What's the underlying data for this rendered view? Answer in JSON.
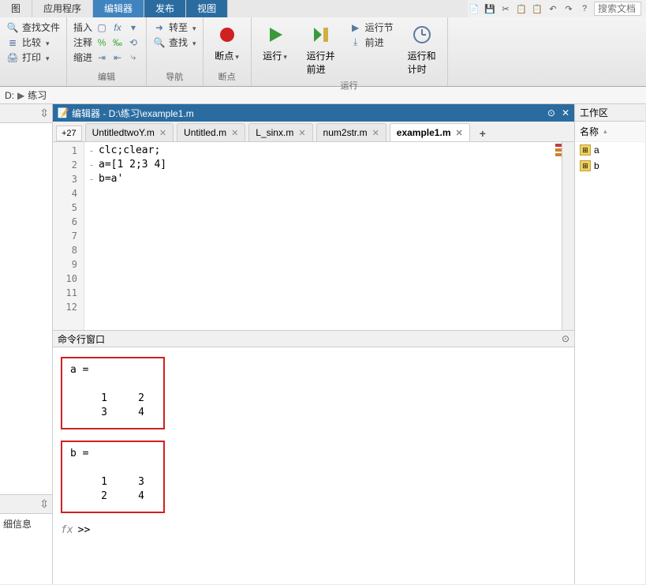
{
  "top_tabs": {
    "t0": "图",
    "t1": "应用程序",
    "t2": "编辑器",
    "t3": "发布",
    "t4": "视图"
  },
  "search": {
    "placeholder": "搜索文档"
  },
  "ribbon": {
    "g_files": {
      "find_files": "查找文件",
      "compare": "比较",
      "print": "打印"
    },
    "g_edit": {
      "insert": "插入",
      "comment": "注释",
      "indent": "缩进",
      "label": "编辑"
    },
    "g_nav": {
      "goto": "转至",
      "find": "查找",
      "label": "导航"
    },
    "g_break": {
      "break": "断点",
      "label": "断点"
    },
    "g_run": {
      "run": "运行",
      "run_section": "运行节",
      "run_advance": "运行并\n前进",
      "advance": "前进",
      "run_time": "运行和\n计时",
      "label": "运行"
    }
  },
  "path": {
    "drive": "D:",
    "folder": "练习"
  },
  "editor": {
    "title": "编辑器 - D:\\练习\\example1.m",
    "numtab": "+27",
    "tabs": {
      "t0": "UntitledtwoY.m",
      "t1": "Untitled.m",
      "t2": "L_sinx.m",
      "t3": "num2str.m",
      "t4": "example1.m"
    },
    "lines": {
      "l1": "clc;clear;",
      "l2": "a=[1 2;3 4]",
      "l3": "b=a'"
    }
  },
  "cmd": {
    "title": "命令行窗口",
    "out_a_head": "a =",
    "out_a_r1": "     1     2",
    "out_a_r2": "     3     4",
    "out_b_head": "b =",
    "out_b_r1": "     1     3",
    "out_b_r2": "     2     4",
    "prompt": ">>"
  },
  "ws": {
    "title": "工作区",
    "col": "名称",
    "v0": "a",
    "v1": "b"
  },
  "detail_label": "细信息"
}
